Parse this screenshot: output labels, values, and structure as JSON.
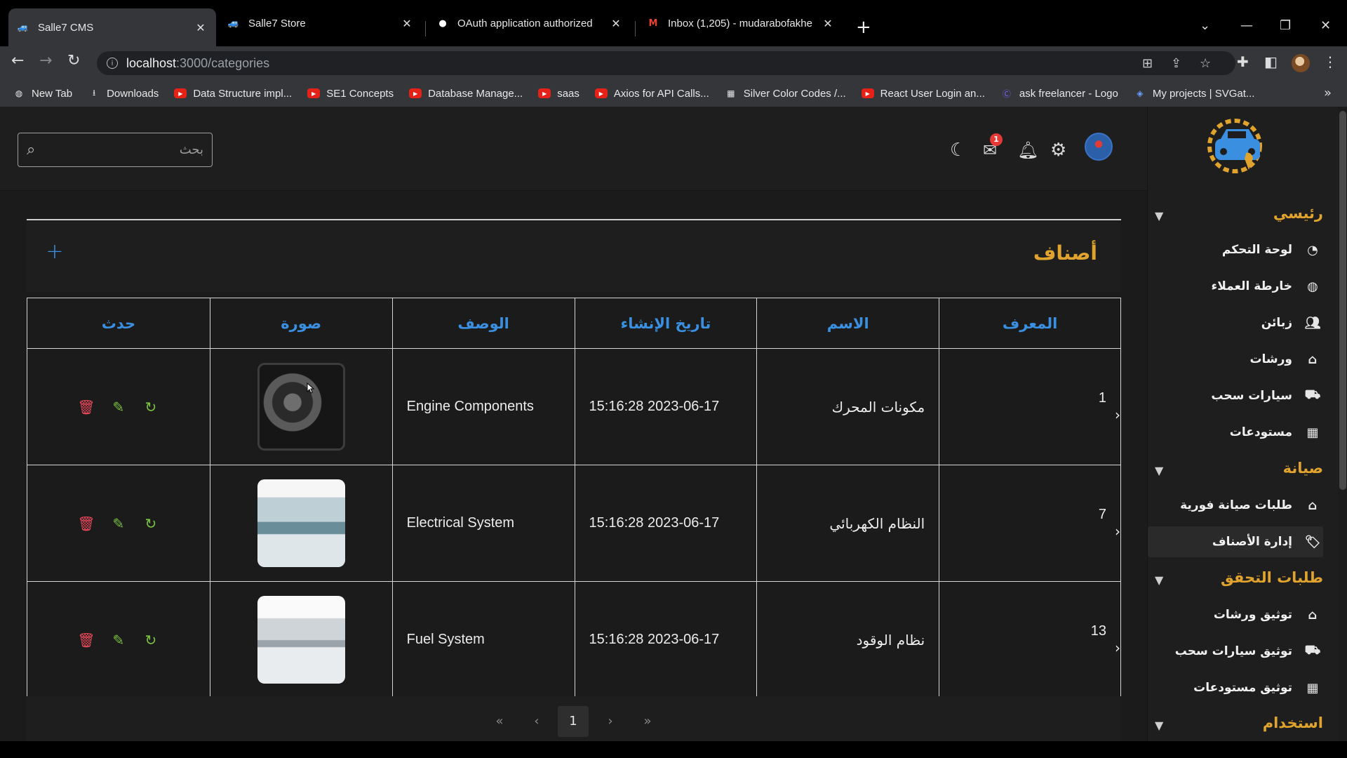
{
  "browser": {
    "tabs": [
      {
        "title": "Salle7 CMS",
        "icon": "car-favicon",
        "active": true
      },
      {
        "title": "Salle7 Store",
        "icon": "car-favicon",
        "active": false
      },
      {
        "title": "OAuth application authorized",
        "icon": "github-icon",
        "active": false
      },
      {
        "title": "Inbox (1,205) - mudarabofakhe",
        "icon": "gmail-icon",
        "active": false
      }
    ],
    "url_host": "localhost",
    "url_path": ":3000/categories",
    "bookmarks": [
      {
        "label": "New Tab",
        "icon": "globe-icon"
      },
      {
        "label": "Downloads",
        "icon": "download-icon"
      },
      {
        "label": "Data Structure impl...",
        "icon": "youtube-icon"
      },
      {
        "label": "SE1 Concepts",
        "icon": "youtube-icon"
      },
      {
        "label": "Database Manage...",
        "icon": "youtube-icon"
      },
      {
        "label": "saas",
        "icon": "youtube-icon"
      },
      {
        "label": "Axios for API Calls...",
        "icon": "youtube-icon"
      },
      {
        "label": "Silver Color Codes /...",
        "icon": "grid-icon"
      },
      {
        "label": "React User Login an...",
        "icon": "youtube-icon"
      },
      {
        "label": "ask freelancer - Logo",
        "icon": "c-logo-icon"
      },
      {
        "label": "My projects | SVGat...",
        "icon": "svg-icon"
      }
    ]
  },
  "header": {
    "search_placeholder": "بحث",
    "messages_badge": "1"
  },
  "page": {
    "title": "أصناف",
    "add_label": "+"
  },
  "table": {
    "columns": {
      "id": "المعرف",
      "name": "الاسم",
      "created": "تاريخ الإنشاء",
      "description": "الوصف",
      "image": "صورة",
      "action": "حدث"
    },
    "rows": [
      {
        "id": "1",
        "name": "مكونات المحرك",
        "created": "2023-06-17 15:16:28",
        "description": "Engine Components",
        "image": "engine-photo"
      },
      {
        "id": "7",
        "name": "النظام الكهربائي",
        "created": "2023-06-17 15:16:28",
        "description": "Electrical System",
        "image": "car-electrical-photo"
      },
      {
        "id": "13",
        "name": "نظام الوقود",
        "created": "2023-06-17 15:16:28",
        "description": "Fuel System",
        "image": "car-fuel-photo"
      }
    ]
  },
  "pagination": {
    "first": "«",
    "prev": "‹",
    "current": "1",
    "next": "›",
    "last": "»"
  },
  "sidebar": {
    "sections": [
      {
        "title": "رئيسي",
        "items": [
          {
            "label": "لوحة التحكم",
            "icon": "pie-chart-icon"
          },
          {
            "label": "خارطة العملاء",
            "icon": "globe-icon"
          },
          {
            "label": "زبائن",
            "icon": "users-icon"
          },
          {
            "label": "ورشات",
            "icon": "house-icon"
          },
          {
            "label": "سيارات سحب",
            "icon": "tow-truck-icon"
          },
          {
            "label": "مستودعات",
            "icon": "building-icon"
          }
        ]
      },
      {
        "title": "صيانة",
        "items": [
          {
            "label": "طلبات صيانة فورية",
            "icon": "house-gear-icon"
          },
          {
            "label": "إدارة الأصناف",
            "icon": "tag-icon",
            "active": true
          }
        ]
      },
      {
        "title": "طلبات التحقق",
        "items": [
          {
            "label": "توثيق ورشات",
            "icon": "house-check-icon"
          },
          {
            "label": "توثيق سيارات سحب",
            "icon": "tow-truck-icon"
          },
          {
            "label": "توثيق مستودعات",
            "icon": "building-check-icon"
          }
        ]
      },
      {
        "title": "استخدام",
        "items": []
      }
    ]
  },
  "colors": {
    "accent_gold": "#e0a32d",
    "accent_blue": "#3a8fe0",
    "delete_red": "#e5485a",
    "edit_green": "#7cc242",
    "badge_red": "#e53935"
  }
}
